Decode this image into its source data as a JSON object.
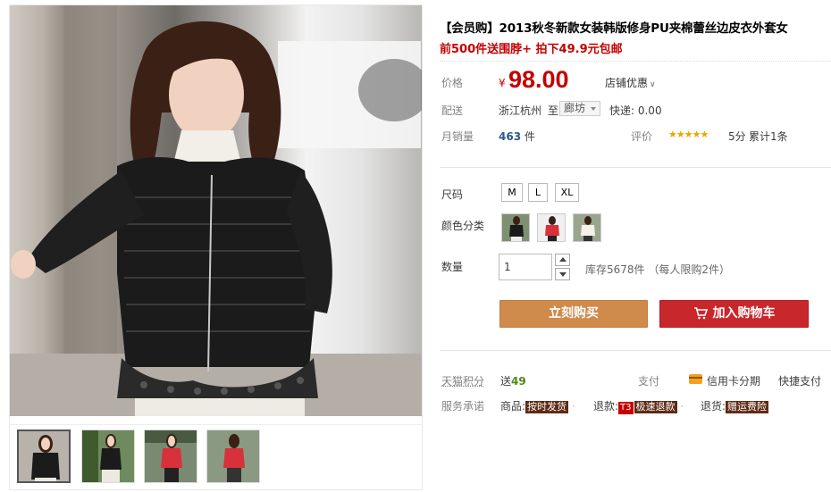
{
  "gallery": {
    "thumbnails": [
      "thumb-1",
      "thumb-2",
      "thumb-3",
      "thumb-4"
    ],
    "active_index": 0
  },
  "product": {
    "title": "【会员购】2013秋冬新款女装韩版修身PU夹棉蕾丝边皮衣外套女",
    "subtitle": "前500件送围脖+ 拍下49.9元包邮"
  },
  "price": {
    "label": "价格",
    "currency": "¥",
    "value": "98.00",
    "store_offer": "店铺优惠"
  },
  "delivery": {
    "label": "配送",
    "from": "浙江杭州",
    "to_word": "至",
    "to_city": "廊坊",
    "shipping": "快递: 0.00"
  },
  "sales": {
    "label": "月销量",
    "count": "463",
    "unit": "件",
    "rating_label": "评价",
    "stars": "★★★★★",
    "rating_value": 5,
    "score": "5分",
    "cumulative": "累计1条"
  },
  "options": {
    "size_label": "尺码",
    "sizes": [
      "M",
      "L",
      "XL"
    ],
    "color_label": "颜色分类",
    "colors": [
      "black",
      "red",
      "white"
    ],
    "quantity_label": "数量",
    "quantity": "1",
    "stock": "库存5678件 （每人限购2件）"
  },
  "actions": {
    "buy_now": "立刻购买",
    "add_to_cart": "加入购物车"
  },
  "services": {
    "points_label": "天猫积分",
    "points_prefix": "送",
    "points_value": "49",
    "pay_label": "支付",
    "credit_card": "信用卡分期",
    "quick_pay": "快捷支付",
    "promise_label": "服务承诺",
    "goods_prefix": "商品:",
    "goods_tag": "按时发货",
    "refund_prefix": "退款:",
    "refund_t3": "T3",
    "refund_tag": "极速退款",
    "return_prefix": "退货:",
    "return_tag": "赠运费险",
    "sep": "·"
  },
  "colors": {
    "price_red": "#c40000",
    "buy_orange": "#cf8a4c",
    "cart_red": "#c8272b",
    "link_blue": "#2b5a89",
    "points_green": "#4b8a0e"
  }
}
